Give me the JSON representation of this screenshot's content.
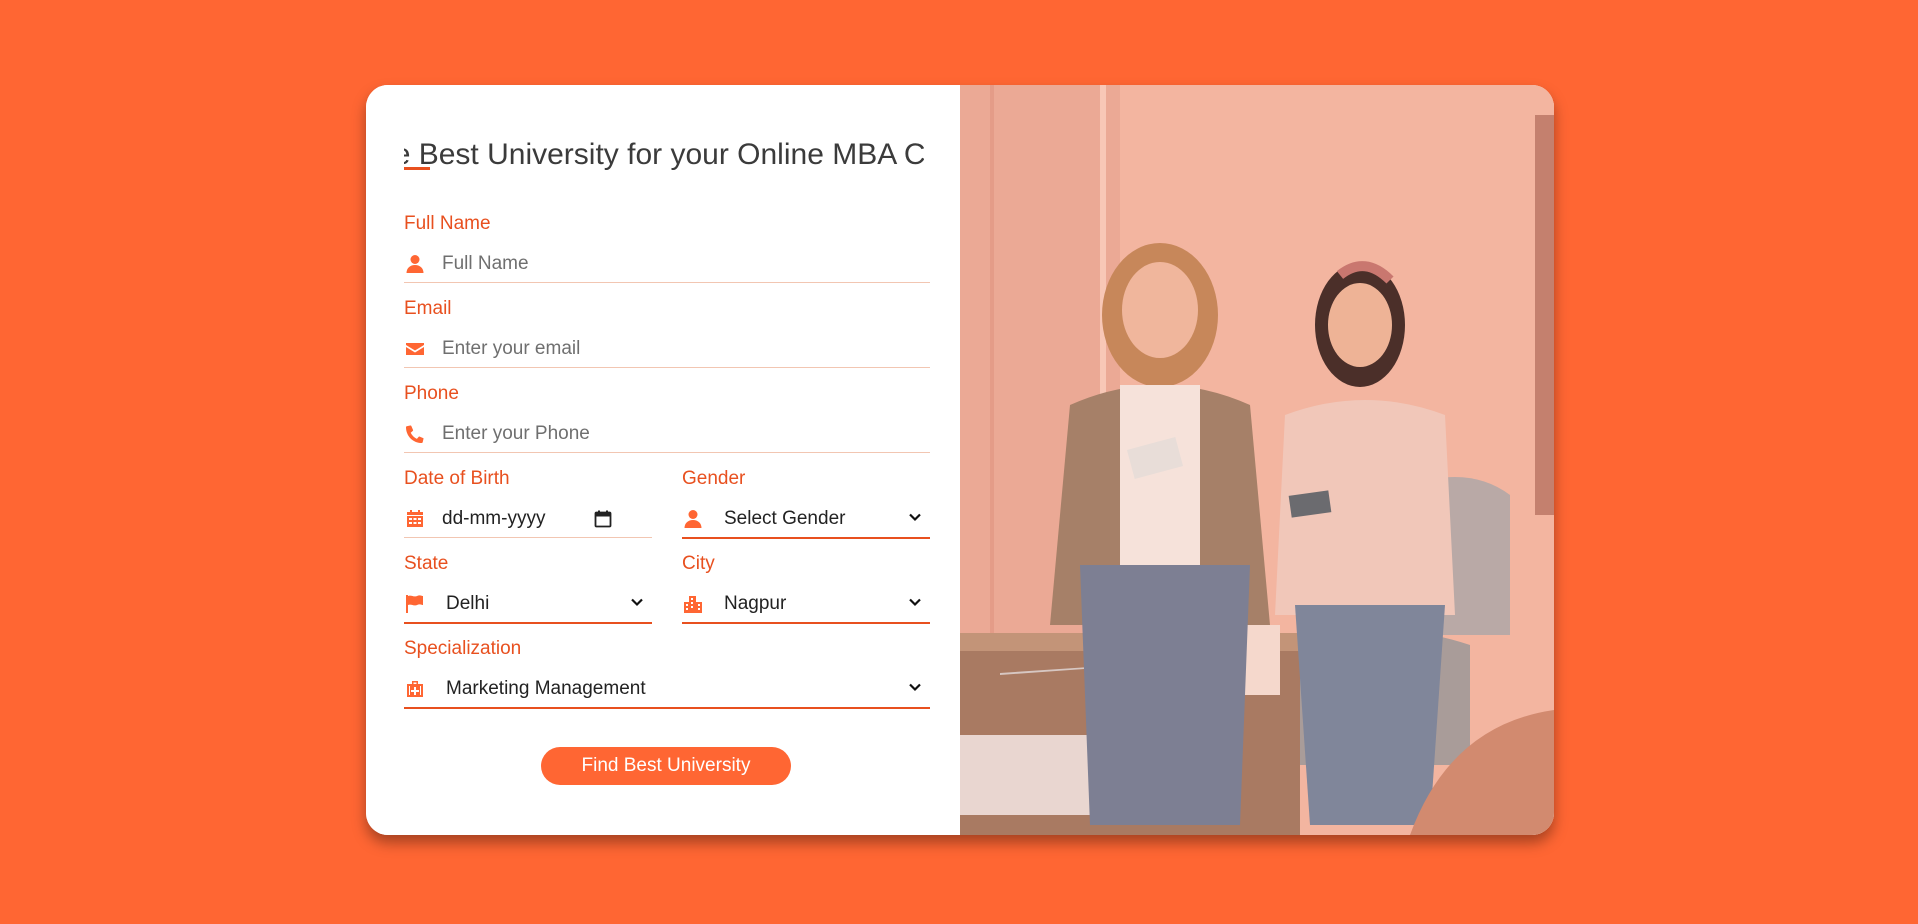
{
  "form": {
    "title": "Find the Best University for your Online MBA Course",
    "full_name": {
      "label": "Full Name",
      "placeholder": "Full Name",
      "icon": "user-icon"
    },
    "email": {
      "label": "Email",
      "placeholder": "Enter your email",
      "icon": "envelope-icon"
    },
    "phone": {
      "label": "Phone",
      "placeholder": "Enter your Phone",
      "icon": "phone-icon"
    },
    "dob": {
      "label": "Date of Birth",
      "placeholder": "dd-mm-yyyy",
      "icon": "calendar-icon"
    },
    "gender": {
      "label": "Gender",
      "value": "Select Gender",
      "icon": "user-icon"
    },
    "state": {
      "label": "State",
      "value": "Delhi",
      "icon": "flag-icon"
    },
    "city": {
      "label": "City",
      "value": "Nagpur",
      "icon": "city-icon"
    },
    "specialization": {
      "label": "Specialization",
      "value": "Marketing Management",
      "icon": "briefcase-medical-icon"
    },
    "submit_label": "Find Best University"
  },
  "colors": {
    "accent": "#ff6633",
    "label": "#e8501f",
    "background": "#ff6633"
  }
}
